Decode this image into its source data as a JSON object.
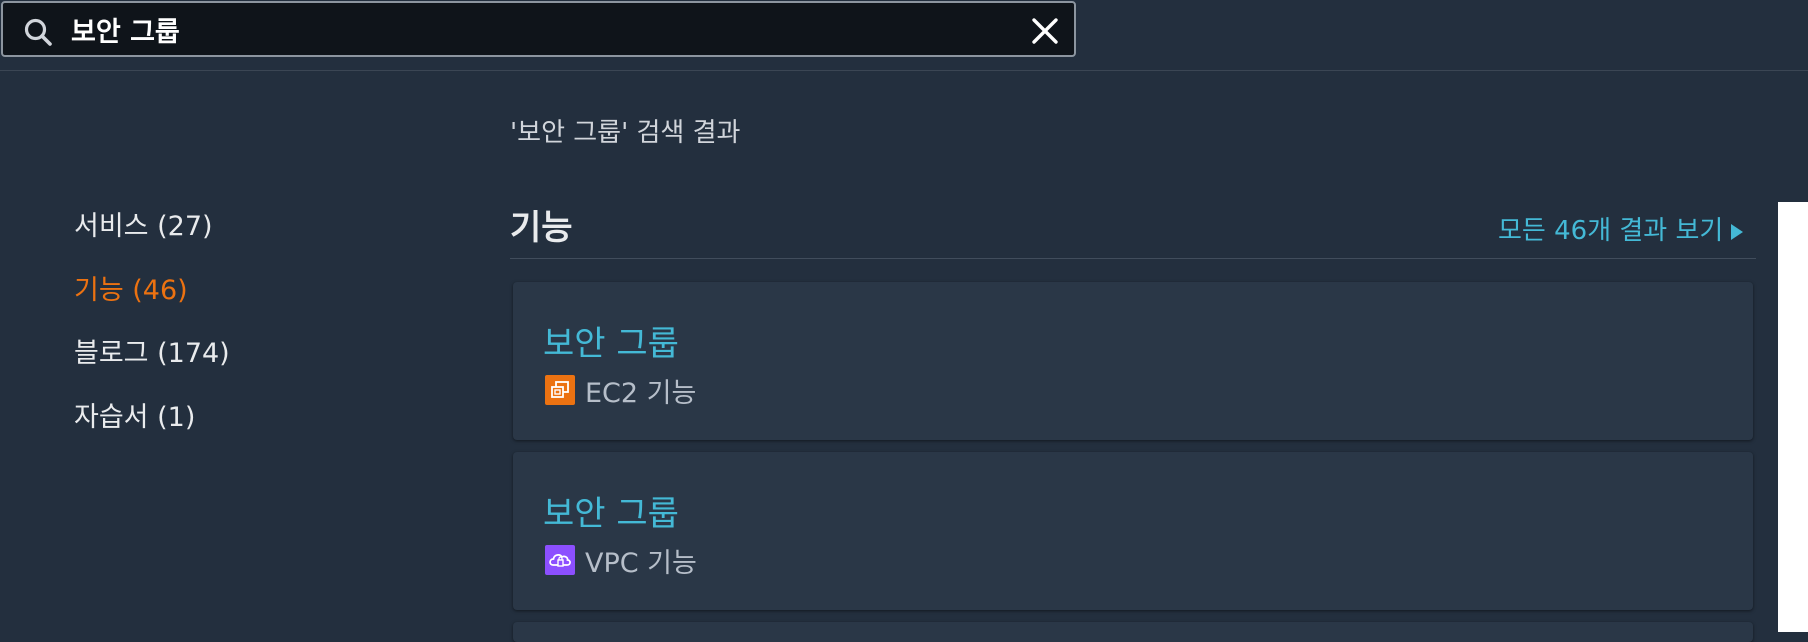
{
  "search": {
    "value": "보안 그룹",
    "icon": "search-icon",
    "clear_icon": "close-icon"
  },
  "results_heading": "'보안 그룹' 검색 결과",
  "filters": [
    {
      "label": "서비스 (27)",
      "active": false
    },
    {
      "label": "기능 (46)",
      "active": true
    },
    {
      "label": "블로그 (174)",
      "active": false
    },
    {
      "label": "자습서 (1)",
      "active": false
    }
  ],
  "section": {
    "title": "기능",
    "view_all": "모든 46개 결과 보기"
  },
  "results": [
    {
      "title": "보안 그룹",
      "service_label": "EC2 기능",
      "service_icon": "ec2-icon",
      "icon_color": "#ec7211"
    },
    {
      "title": "보안 그룹",
      "service_label": "VPC 기능",
      "service_icon": "vpc-icon",
      "icon_color": "#8c4fff"
    }
  ],
  "colors": {
    "background": "#232f3e",
    "accent_orange": "#ec7211",
    "link_blue": "#44b9d6"
  }
}
